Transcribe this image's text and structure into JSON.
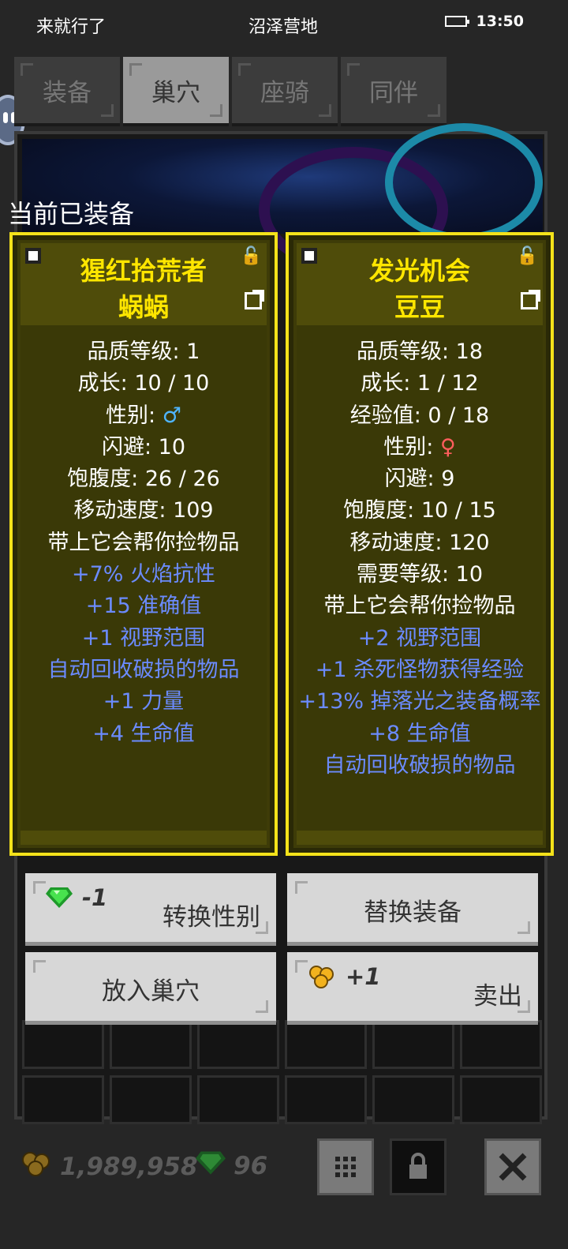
{
  "status_bar": {
    "left_text": "来就行了",
    "center_text": "沼泽营地",
    "time": "13:50",
    "battery_level": 0.45
  },
  "tabs": [
    {
      "label": "装备",
      "active": false
    },
    {
      "label": "巢穴",
      "active": true
    },
    {
      "label": "座骑",
      "active": false
    },
    {
      "label": "同伴",
      "active": false
    }
  ],
  "section_title": "当前已装备",
  "cards": [
    {
      "name": "猩红拾荒者",
      "pet_name": "蜗蜗",
      "lines": [
        {
          "text": "品质等级: 1",
          "style": "white"
        },
        {
          "text": "成长: 10 / 10",
          "style": "white"
        },
        {
          "text": "性别: ",
          "style": "white",
          "symbol": "♂",
          "symbol_style": "male"
        },
        {
          "text": "闪避: 10",
          "style": "white"
        },
        {
          "text": "饱腹度: 26 / 26",
          "style": "white"
        },
        {
          "text": "移动速度: 109",
          "style": "white"
        },
        {
          "text": "带上它会帮你捡物品",
          "style": "white"
        },
        {
          "text": "+7% 火焰抗性",
          "style": "blue"
        },
        {
          "text": "+15 准确值",
          "style": "blue"
        },
        {
          "text": "+1 视野范围",
          "style": "blue"
        },
        {
          "text": "自动回收破损的物品",
          "style": "blue"
        },
        {
          "text": "+1 力量",
          "style": "blue"
        },
        {
          "text": "+4 生命值",
          "style": "blue"
        }
      ]
    },
    {
      "name": "发光机会",
      "pet_name": "豆豆",
      "lines": [
        {
          "text": "品质等级: 18",
          "style": "white"
        },
        {
          "text": "成长: 1 / 12",
          "style": "white"
        },
        {
          "text": "经验值: 0 / 18",
          "style": "white"
        },
        {
          "text": "性别: ",
          "style": "white",
          "symbol": "♀",
          "symbol_style": "female"
        },
        {
          "text": "闪避: 9",
          "style": "white"
        },
        {
          "text": "饱腹度: 10 / 15",
          "style": "white"
        },
        {
          "text": "移动速度: 120",
          "style": "white"
        },
        {
          "text": "需要等级: 10",
          "style": "white"
        },
        {
          "text": "带上它会帮你捡物品",
          "style": "white"
        },
        {
          "text": "+2 视野范围",
          "style": "blue"
        },
        {
          "text": "+1 杀死怪物获得经验",
          "style": "blue"
        },
        {
          "text": "+13% 掉落光之装备概率",
          "style": "blue"
        },
        {
          "text": "+8 生命值",
          "style": "blue"
        },
        {
          "text": "自动回收破损的物品",
          "style": "blue"
        }
      ]
    }
  ],
  "buttons": {
    "change_gender": {
      "cost": "-1",
      "label": "转换性别"
    },
    "replace_equipment": {
      "label": "替换装备"
    },
    "put_in_nest": {
      "label": "放入巢穴"
    },
    "sell": {
      "cost": "+1",
      "label": "卖出"
    }
  },
  "currency": {
    "gold": "1,989,958",
    "gems": "96"
  },
  "colors": {
    "card_border": "#f4e21a",
    "card_title": "#ffe600",
    "blue_stat": "#6b8bff",
    "male": "#4fb5ff",
    "female": "#ff5d5d"
  }
}
